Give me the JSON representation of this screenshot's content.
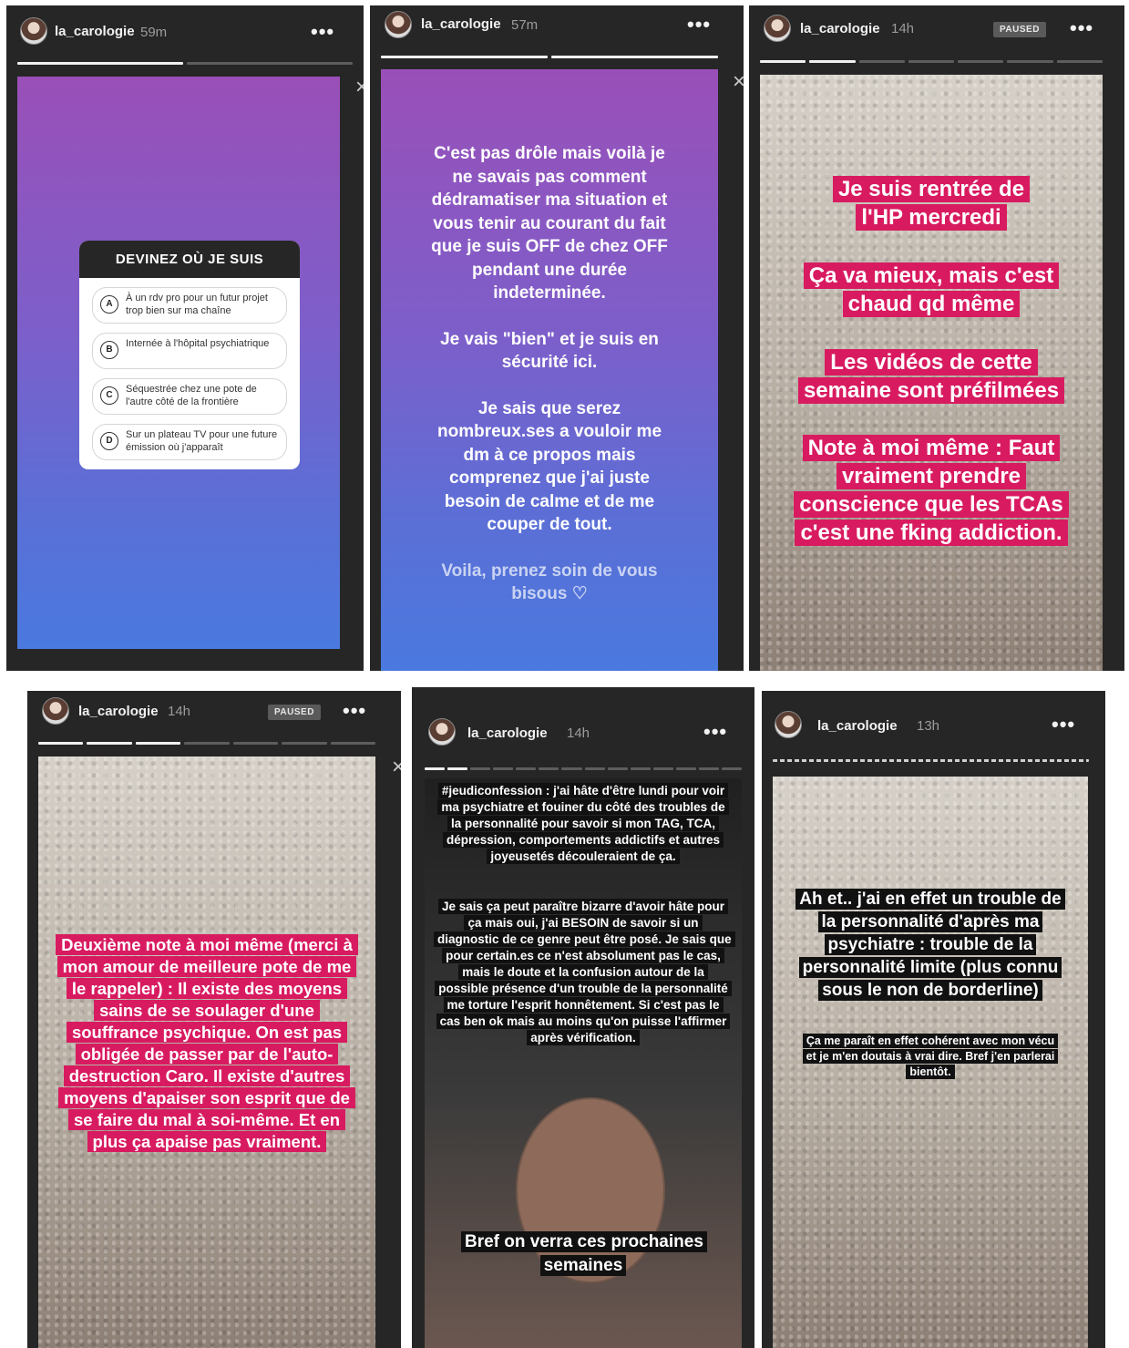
{
  "panels": [
    {
      "username": "la_carologie",
      "time": "59m",
      "menu": "•••"
    },
    {
      "username": "la_carologie",
      "time": "57m",
      "menu": "•••"
    },
    {
      "username": "la_carologie",
      "time": "14h",
      "paused": "PAUSED",
      "menu": "•••"
    },
    {
      "username": "la_carologie",
      "time": "14h",
      "paused": "PAUSED",
      "menu": "•••"
    },
    {
      "username": "la_carologie",
      "time": "14h",
      "menu": "•••"
    },
    {
      "username": "la_carologie",
      "time": "13h",
      "menu": "•••"
    }
  ],
  "quiz": {
    "title": "DEVINEZ OÙ JE SUIS",
    "options": [
      {
        "letter": "A",
        "text": "À un rdv pro pour un futur projet trop bien sur ma chaîne"
      },
      {
        "letter": "B",
        "text": "Internée à l'hôpital psychiatrique"
      },
      {
        "letter": "C",
        "text": "Séquestrée chez une pote de l'autre côté de la frontière"
      },
      {
        "letter": "D",
        "text": "Sur un plateau TV pour une future émission où j'apparaît"
      }
    ]
  },
  "story2": {
    "p1": "C'est pas drôle mais voilà je ne savais pas comment dédramatiser ma situation et vous tenir au courant du fait que je suis OFF de chez OFF pendant une durée indeterminée.",
    "p2": "Je vais \"bien\" et je suis en sécurité ici.",
    "p3": "Je sais que serez nombreux.ses a vouloir me dm à ce propos mais comprenez que j'ai juste besoin de calme et de me couper de tout.",
    "p4": "Voila, prenez soin de vous bisous ♡"
  },
  "story3": {
    "l1": "Je suis rentrée de l'HP mercredi",
    "l2": "Ça va mieux, mais c'est chaud qd même",
    "l3": "Les vidéos de cette semaine sont préfilmées",
    "l4": "Note à moi même : Faut vraiment prendre conscience que les TCAs c'est une fking addiction."
  },
  "story4": {
    "text": "Deuxième note à moi même (merci à mon amour de meilleure pote de me le rappeler) : Il existe des moyens sains de se soulager d'une souffrance psychique. On est pas obligée de passer par de l'auto-destruction Caro. Il existe d'autres moyens d'apaiser son esprit que de se faire du mal à soi-même. Et en plus ça apaise pas vraiment."
  },
  "story5": {
    "p1": "#jeudiconfession : j'ai hâte d'être lundi pour voir ma psychiatre et fouiner du côté des troubles de la personnalité pour savoir si mon TAG, TCA, dépression, comportements addictifs et autres joyeusetés découleraient de ça.",
    "p2": "Je sais ça peut paraître bizarre d'avoir hâte pour ça mais oui, j'ai BESOIN de savoir si un diagnostic de ce genre peut être posé. Je sais que pour certain.es ce n'est absolument pas le cas, mais le doute et la confusion autour de la possible présence d'un trouble de la personnalité me torture l'esprit honnêtement. Si c'est pas le cas ben ok mais au moins qu'on puisse l'affirmer après vérification.",
    "p3": "Bref on verra ces prochaines semaines"
  },
  "story6": {
    "p1": "Ah et.. j'ai en effet un trouble de la personnalité d'après ma psychiatre : trouble de la personnalité limite (plus connu sous le non de borderline)",
    "p2": "Ça me paraît en effet cohérent avec mon vécu et je m'en doutais à vrai dire. Bref j'en parlerai bientôt."
  }
}
